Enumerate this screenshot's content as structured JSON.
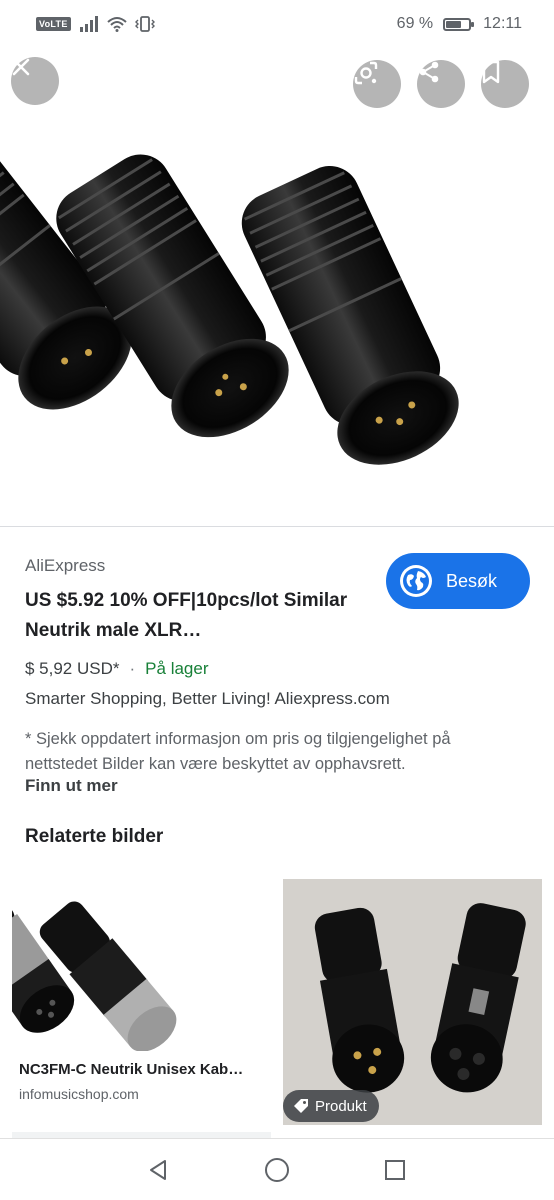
{
  "status_bar": {
    "volte": "VoLTE",
    "battery_text": "69 %",
    "battery_level": 0.69,
    "time": "12:11"
  },
  "hero": {
    "close_icon": "close-icon",
    "lens_icon": "lens-icon",
    "share_icon": "share-icon",
    "bookmark_icon": "bookmark-icon"
  },
  "result": {
    "source": "AliExpress",
    "title": "US $5.92 10% OFF|10pcs/lot Similar Neutrik male XLR…",
    "visit_label": "Besøk",
    "price": "$ 5,92 USD*",
    "separator": "·",
    "availability": "På lager",
    "description": "Smarter Shopping, Better Living! Aliexpress.com",
    "disclaimer": "* Sjekk oppdatert informasjon om pris og tilgjengelighet på nettstedet Bilder kan være beskyttet av opphavsrett.",
    "more_link": "Finn ut mer"
  },
  "related": {
    "heading": "Relaterte bilder",
    "cards": [
      {
        "title": "NC3FM-C Neutrik Unisex Kab…",
        "domain": "infomusicshop.com"
      },
      {
        "badge": "Produkt"
      }
    ]
  },
  "colors": {
    "accent": "#1a73e8",
    "in_stock": "#188038"
  }
}
